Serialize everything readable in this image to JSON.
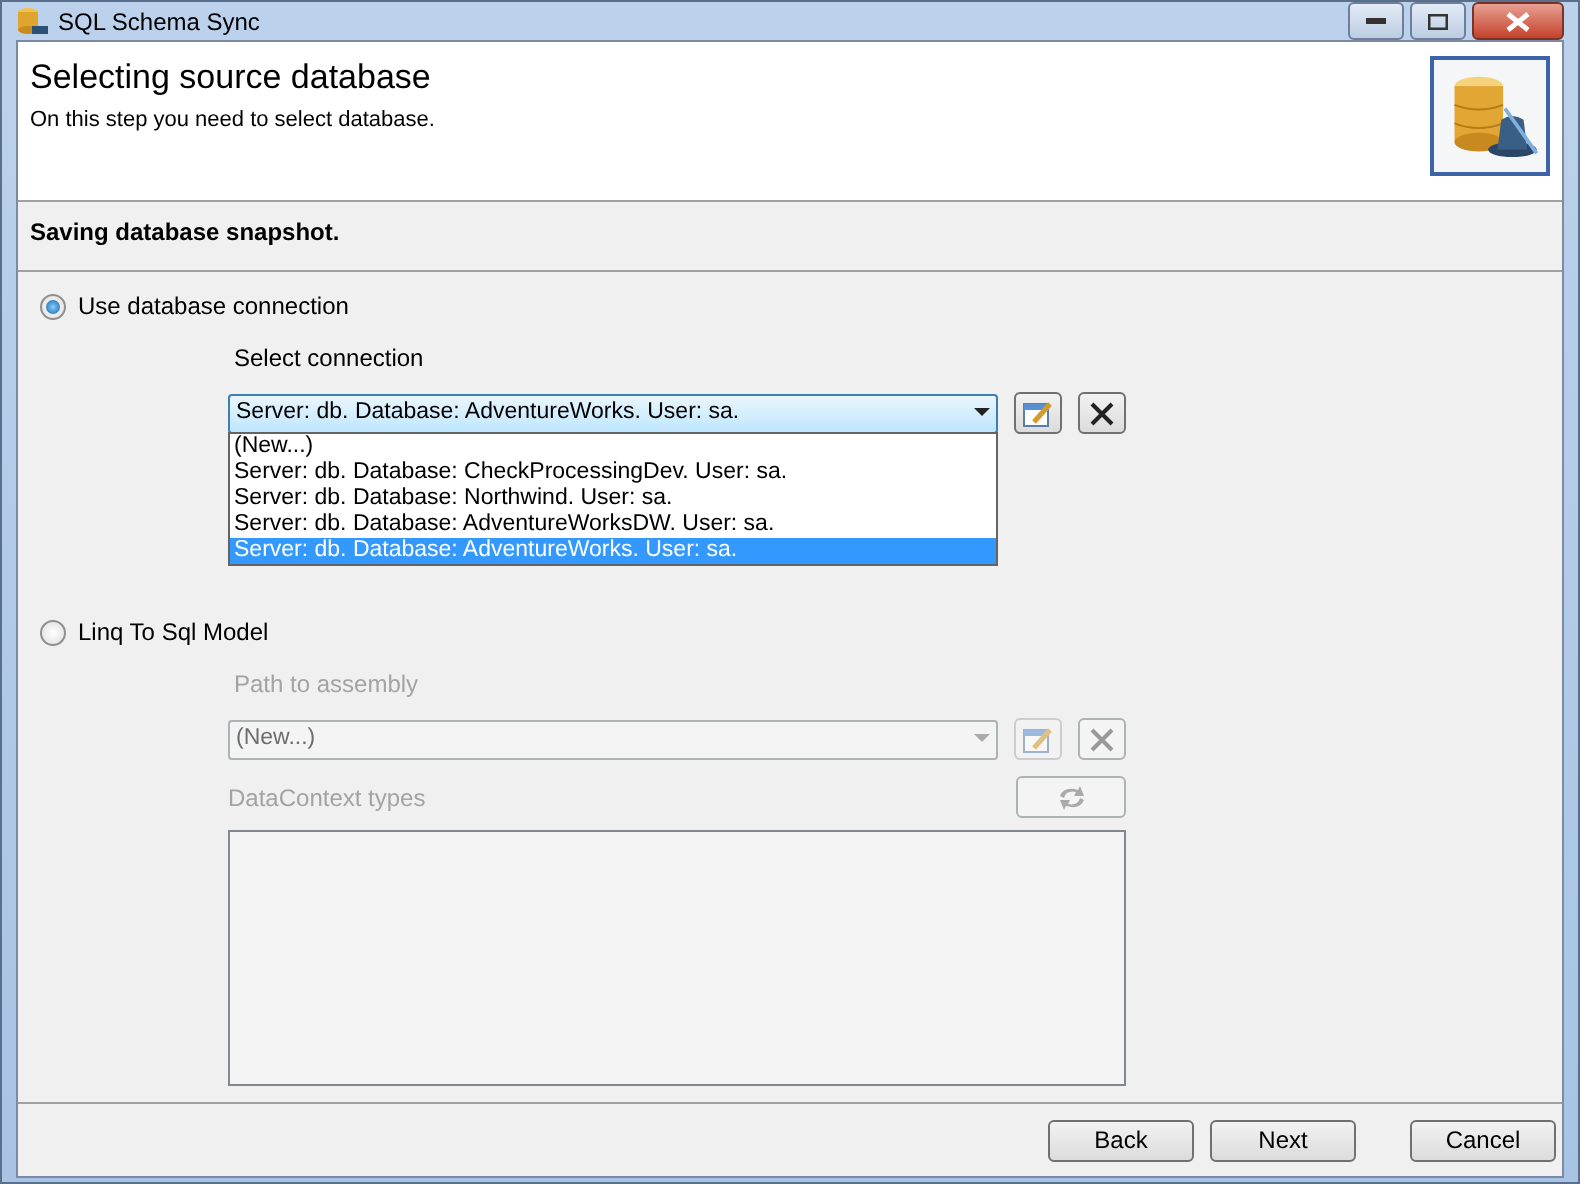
{
  "window": {
    "title": "SQL Schema Sync"
  },
  "header": {
    "title": "Selecting source database",
    "subtitle": "On this step you need to select database."
  },
  "status": "Saving database snapshot.",
  "sections": [
    {
      "label": "Use database connection",
      "selected": true,
      "disabled": false,
      "field_label": "Select connection",
      "combo_value": "Server: db. Database: AdventureWorks. User: sa.",
      "expanded": true,
      "items": [
        {
          "text": "(New...)",
          "selected": false
        },
        {
          "text": "Server: db. Database: CheckProcessingDev. User: sa.",
          "selected": false
        },
        {
          "text": "Server: db. Database: Northwind. User: sa.",
          "selected": false
        },
        {
          "text": "Server: db. Database: AdventureWorksDW. User: sa.",
          "selected": false
        },
        {
          "text": "Server: db. Database: AdventureWorks. User: sa.",
          "selected": true
        }
      ]
    },
    {
      "label": "Linq To Sql Model",
      "selected": false,
      "disabled": true,
      "field_label": "Path to assembly",
      "combo_value": "(New...)",
      "expanded": false,
      "types_label": "DataContext types"
    }
  ],
  "buttons": [
    {
      "label": "Back"
    },
    {
      "label": "Next"
    },
    {
      "label": "Cancel"
    }
  ]
}
